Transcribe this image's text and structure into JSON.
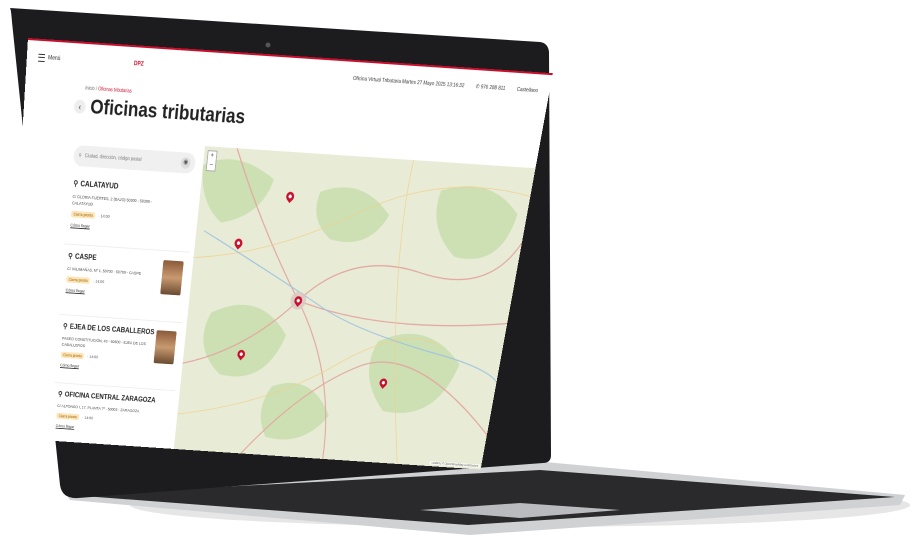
{
  "header": {
    "menu_label": "Menú",
    "logo_text": "DPZ",
    "virtual_office": "Oficina Virtual Tributaria",
    "date_time": "Martes 27 Mayo 2025 13:16:32",
    "phone": "976 288 811",
    "language": "Castellano"
  },
  "breadcrumb": {
    "home": "Inicio",
    "separator": "/",
    "current": "Oficinas tributarias"
  },
  "page_title": "Oficinas tributarias",
  "search": {
    "placeholder": "Ciudad, dirección, código postal"
  },
  "offices": [
    {
      "name": "CALATAYUD",
      "address": "C/ GLORIA FUERTES, 2 (BAJO) 50300 - 50300 - CALATAYUD",
      "status": "Cierra pronto",
      "hours": "· 14:00",
      "link": "Cómo llegar",
      "has_photo": false
    },
    {
      "name": "CASPE",
      "address": "C/ VALIMAÑAS, Nº 1, 50700 - 50700 - CASPE",
      "status": "Cierra pronto",
      "hours": "· 14:00",
      "link": "Cómo llegar",
      "has_photo": true
    },
    {
      "name": "EJEA DE LOS CABALLEROS",
      "address": "PASEO CONSTITUCIÓN, 43 - 50600 - EJEA DE LOS CABALLEROS",
      "status": "Cierra pronto",
      "hours": "· 14:00",
      "link": "Cómo llegar",
      "has_photo": true
    },
    {
      "name": "OFICINA CENTRAL ZARAGOZA",
      "address": "C/ ALFONSO I, 17, PLANTA 7ª - 50003 - ZARAGOZA",
      "status": "Cierra pronto",
      "hours": "· 14:00",
      "link": "Cómo llegar",
      "has_photo": false
    }
  ],
  "map": {
    "zoom_in": "+",
    "zoom_out": "−",
    "attribution": "Leaflet | © OpenStreetMap contributors"
  },
  "colors": {
    "brand_red": "#c8102e",
    "badge_bg": "#ffe6b8"
  }
}
